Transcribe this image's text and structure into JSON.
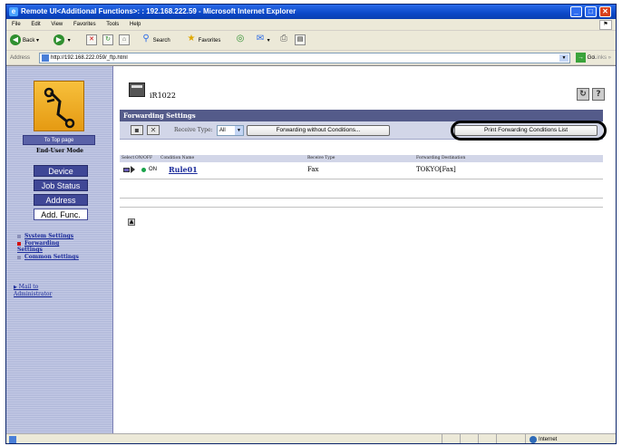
{
  "window": {
    "title": "Remote UI<Additional Functions>: : 192.168.222.59 - Microsoft Internet Explorer",
    "controls": {
      "minimize": "_",
      "maximize": "□",
      "close": "✕"
    }
  },
  "menu": [
    "File",
    "Edit",
    "View",
    "Favorites",
    "Tools",
    "Help"
  ],
  "toolbar": {
    "back": "Back",
    "search": "Search",
    "favorites": "Favorites"
  },
  "address": {
    "label": "Address",
    "url": "http://192.168.222.059/_ftp.html",
    "go": "Go",
    "links": "Links"
  },
  "sidebar": {
    "top_button": "To Top page",
    "mode": "End-User Mode",
    "nav": [
      "Device",
      "Job Status",
      "Address",
      "Add. Func."
    ],
    "sublinks": [
      {
        "label": "System Settings",
        "bullet_color": "#8a8fb8"
      },
      {
        "label": "Forwarding Settings",
        "bullet_color": "#d41010"
      },
      {
        "label": "Common Settings",
        "bullet_color": "#8a8fb8"
      }
    ],
    "mail": "Mail to Administrator"
  },
  "device": {
    "name": "iR1022"
  },
  "forwarding": {
    "title": "Forwarding Settings",
    "receive_type_label": "Receive Type:",
    "receive_type_value": "All",
    "btn_without_conditions": "Forwarding without Conditions...",
    "btn_print_list": "Print Forwarding Conditions List",
    "columns": [
      "Select",
      "ON/OFF",
      "Condition Name",
      "Receive Type",
      "Forwarding Destination"
    ],
    "rows": [
      {
        "onoff": "ON",
        "name": "Rule01",
        "receive_type": "Fax",
        "destination": "TOKYO[Fax]"
      }
    ]
  },
  "status": {
    "zone": "Internet"
  },
  "colors": {
    "accent": "#3f4796",
    "header": "#545b8a",
    "title_bar": "#0b48c8",
    "on_dot": "#1aa34a"
  }
}
